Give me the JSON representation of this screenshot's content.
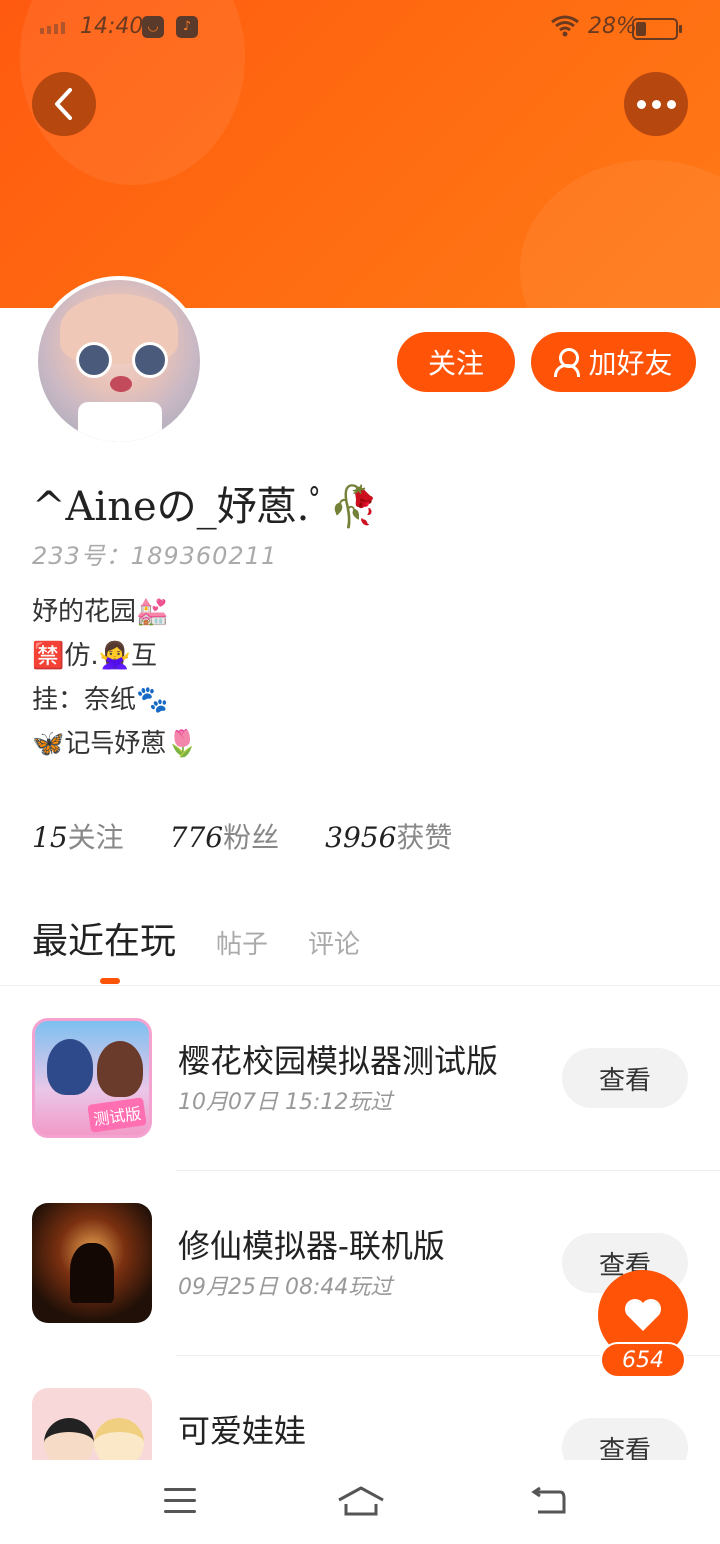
{
  "status_bar": {
    "time": "14:40",
    "battery": "28%",
    "app_icon_1": "bag-icon",
    "app_icon_2": "music-icon"
  },
  "header": {
    "back_icon": "chevron-left-icon",
    "more_icon": "more-dots-icon",
    "accent_color": "#ff5408"
  },
  "actions": {
    "follow_label": "关注",
    "add_friend_label": "加好友"
  },
  "profile": {
    "name": "^Aineの_妤蒽.ﾟ🥀",
    "uid": "233号：189360211",
    "bio": [
      "妤的花园💒",
      "🈲仿.🙅‍♀️互",
      "挂：奈纸🐾",
      "🦋记득妤蒽🌷"
    ]
  },
  "stats": {
    "following_count": "15",
    "following_label": "关注",
    "fans_count": "776",
    "fans_label": "粉丝",
    "likes_count": "3956",
    "likes_label": "获赞"
  },
  "tabs": {
    "active": "最近在玩",
    "posts": "帖子",
    "comments": "评论"
  },
  "games": [
    {
      "title": "樱花校园模拟器测试版",
      "played": "10月07日 15:12玩过",
      "view": "查看",
      "icon_tag": "测试版"
    },
    {
      "title": "修仙模拟器-联机版",
      "played": "09月25日 08:44玩过",
      "view": "查看"
    },
    {
      "title": "可爱娃娃",
      "played": "",
      "view": "查看"
    }
  ],
  "fab": {
    "icon": "heart-icon",
    "count": "654"
  },
  "nav": {
    "menu_icon": "menu-icon",
    "home_icon": "home-icon",
    "back_icon": "return-icon"
  }
}
